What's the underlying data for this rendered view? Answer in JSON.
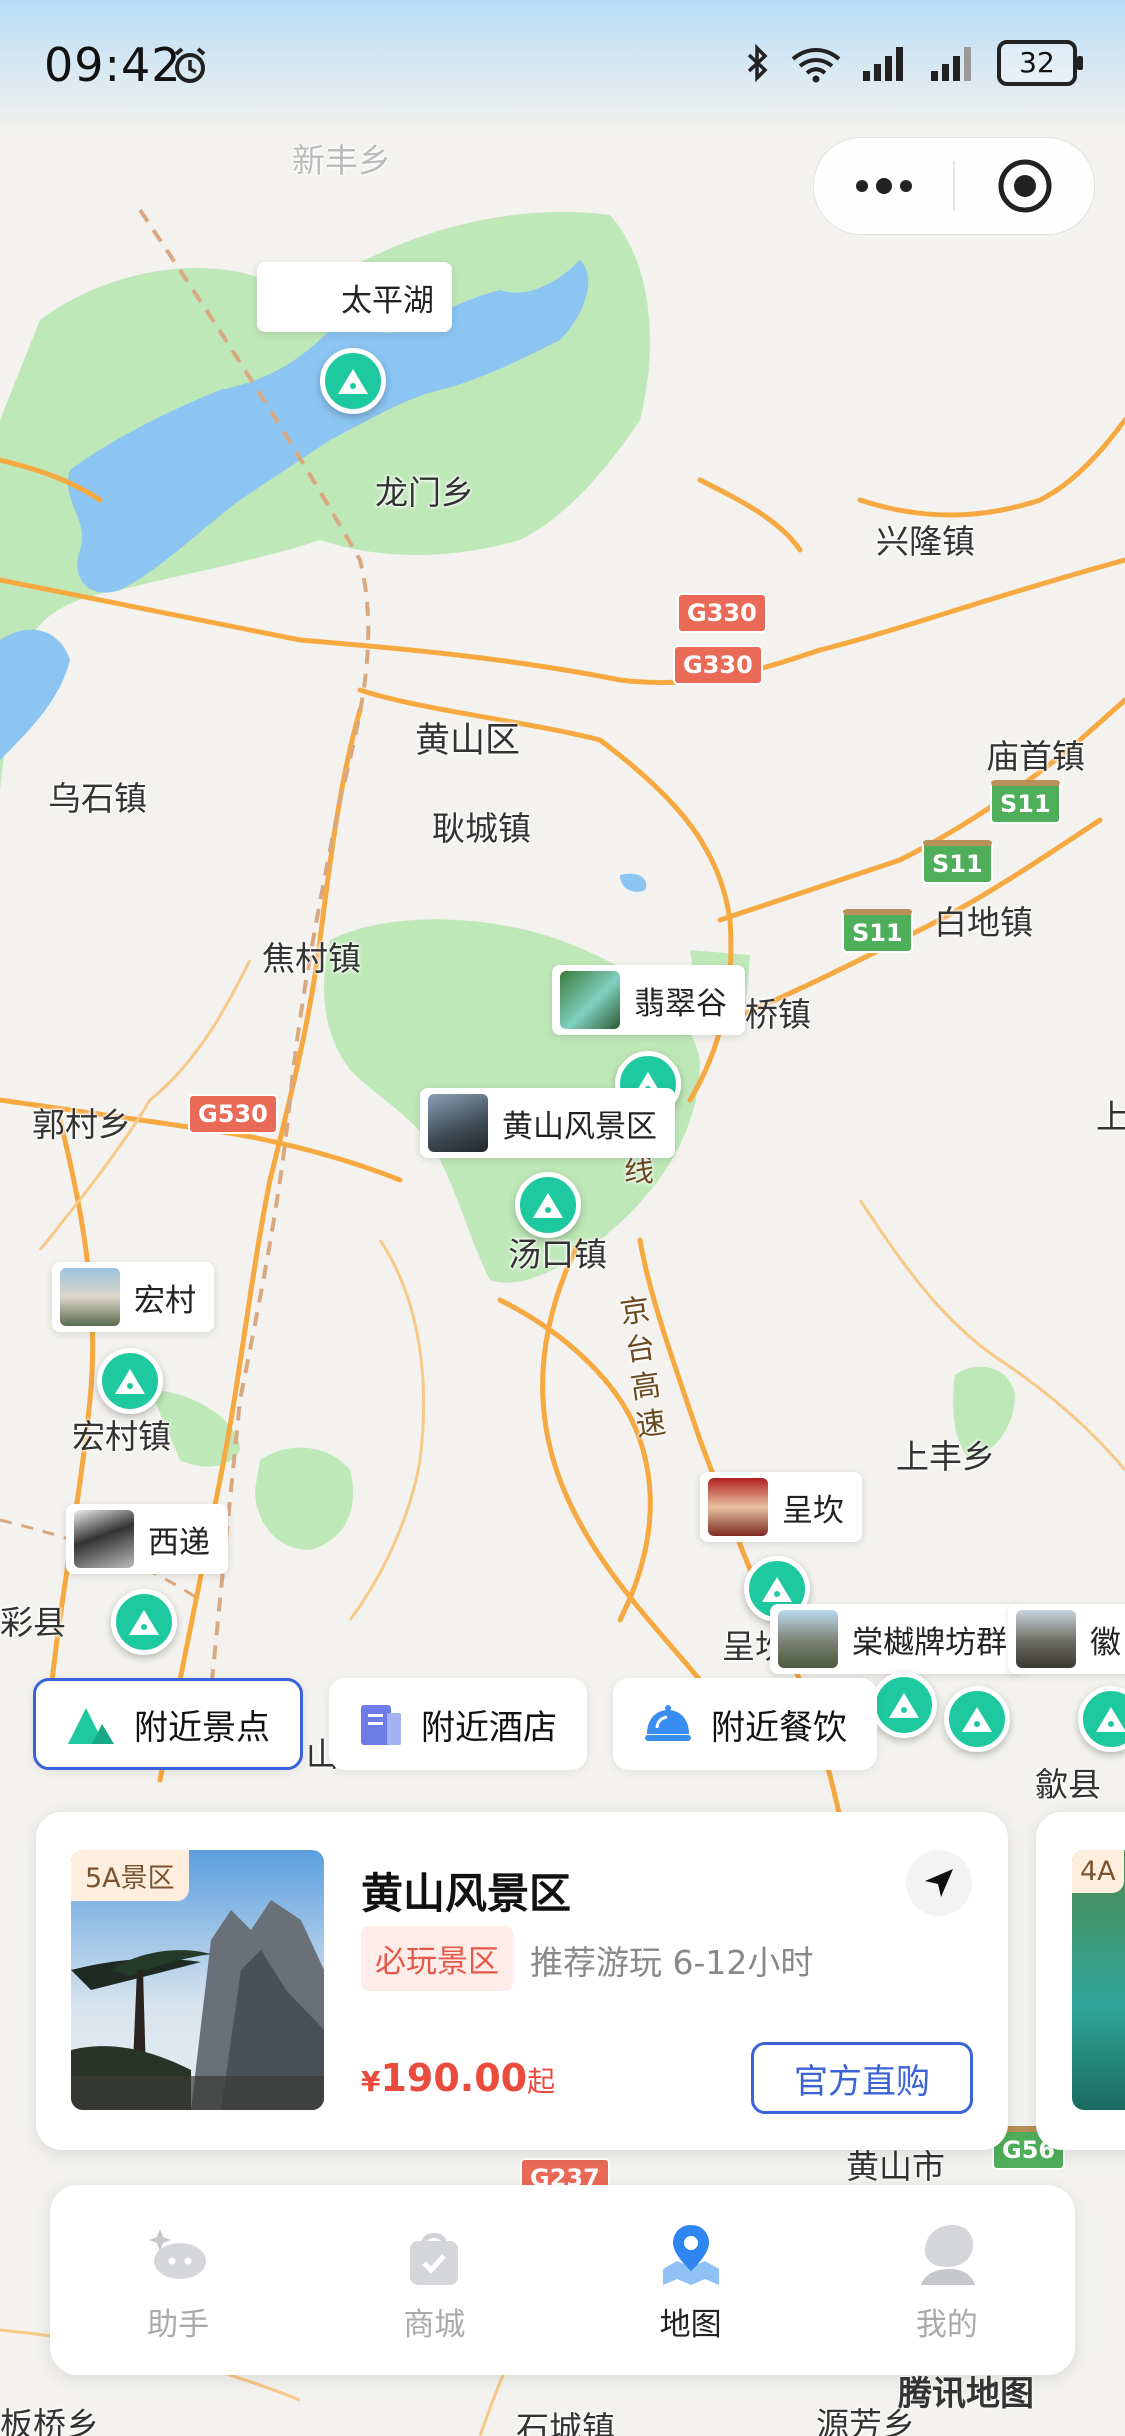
{
  "status_bar": {
    "time": "09:42",
    "battery": "32",
    "icons": [
      "alarm-icon",
      "bluetooth-icon",
      "wifi-icon",
      "signal-icon",
      "signal-icon",
      "battery-icon"
    ]
  },
  "capsule": {
    "menu_icon": "more-dots-icon",
    "close_icon": "target-close-icon"
  },
  "map": {
    "places": [
      "新丰乡",
      "龙门乡",
      "兴隆镇",
      "黄山区",
      "耿城镇",
      "乌石镇",
      "庙首镇",
      "白地镇",
      "焦村镇",
      "桥镇",
      "郭村乡",
      "汤口镇",
      "宏村镇",
      "上丰乡",
      "彩县",
      "呈坎",
      "歙县",
      "板桥乡",
      "石城镇",
      "源芳乡",
      "上",
      "山",
      "黄山市"
    ],
    "roads": [
      "G330",
      "G330",
      "S11",
      "S11",
      "S11",
      "G530",
      "G237",
      "G56"
    ],
    "highway_label": "京台高速",
    "highway_label_2": "线",
    "pois": [
      {
        "name": "太平湖"
      },
      {
        "name": "翡翠谷"
      },
      {
        "name": "黄山风景区"
      },
      {
        "name": "宏村"
      },
      {
        "name": "西递"
      },
      {
        "name": "呈坎"
      },
      {
        "name": "棠樾牌坊群"
      },
      {
        "name": "徽"
      }
    ],
    "watermark": "腾讯地图"
  },
  "filters": [
    {
      "label": "附近景点",
      "icon": "mountain-icon",
      "active": true
    },
    {
      "label": "附近酒店",
      "icon": "hotel-icon",
      "active": false
    },
    {
      "label": "附近餐饮",
      "icon": "dining-icon",
      "active": false
    }
  ],
  "card": {
    "badge": "5A景区",
    "title": "黄山风景区",
    "tag": "必玩景区",
    "subtitle": "推荐游玩 6-12小时",
    "price_currency": "¥",
    "price": "190.00",
    "price_suffix": "起",
    "buy_label": "官方直购",
    "nav_icon": "navigation-arrow-icon",
    "peek_badge": "4A"
  },
  "tabbar": [
    {
      "label": "助手",
      "icon": "assistant-icon",
      "active": false
    },
    {
      "label": "商城",
      "icon": "shop-bag-icon",
      "active": false
    },
    {
      "label": "地图",
      "icon": "map-pin-icon",
      "active": true
    },
    {
      "label": "我的",
      "icon": "profile-icon",
      "active": false
    }
  ],
  "colors": {
    "accent": "#3a63d6",
    "pin": "#1fc9a0",
    "price": "#e94b3c",
    "park_green": "#bfe8b8",
    "lake_blue": "#8cc5f2",
    "road_orange": "#f5a940"
  }
}
